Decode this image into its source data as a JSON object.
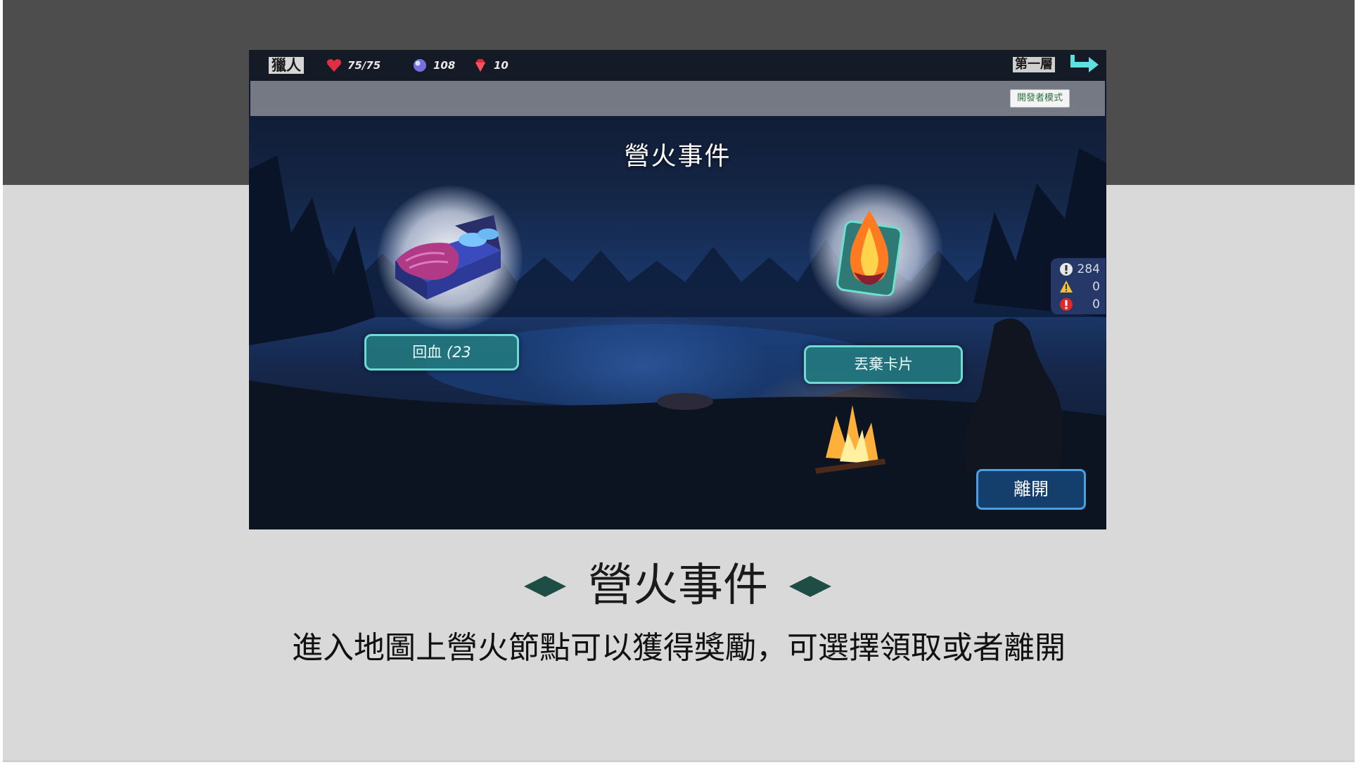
{
  "game": {
    "topbar": {
      "character_name": "獵人",
      "hp": "75/75",
      "gems": "108",
      "rubies": "10",
      "floor": "第一層",
      "icons": [
        "heart-icon",
        "gem-icon",
        "ruby-icon",
        "exit-arrow-icon"
      ]
    },
    "dev_mode_button": "開發者模式",
    "event_title": "營火事件",
    "options": {
      "heal_label": "回血",
      "heal_amount": "(23",
      "discard_label": "丟棄卡片",
      "leave_label": "離開"
    },
    "console_counts": {
      "info": "284",
      "warning": "0",
      "error": "0"
    }
  },
  "slide": {
    "title": "營火事件",
    "description": "進入地圖上營火節點可以獲得獎勵，可選擇領取或者離開"
  },
  "colors": {
    "accent_teal": "#1d4d45",
    "button_teal": "#237d80",
    "leave_blue": "#143f6d"
  }
}
